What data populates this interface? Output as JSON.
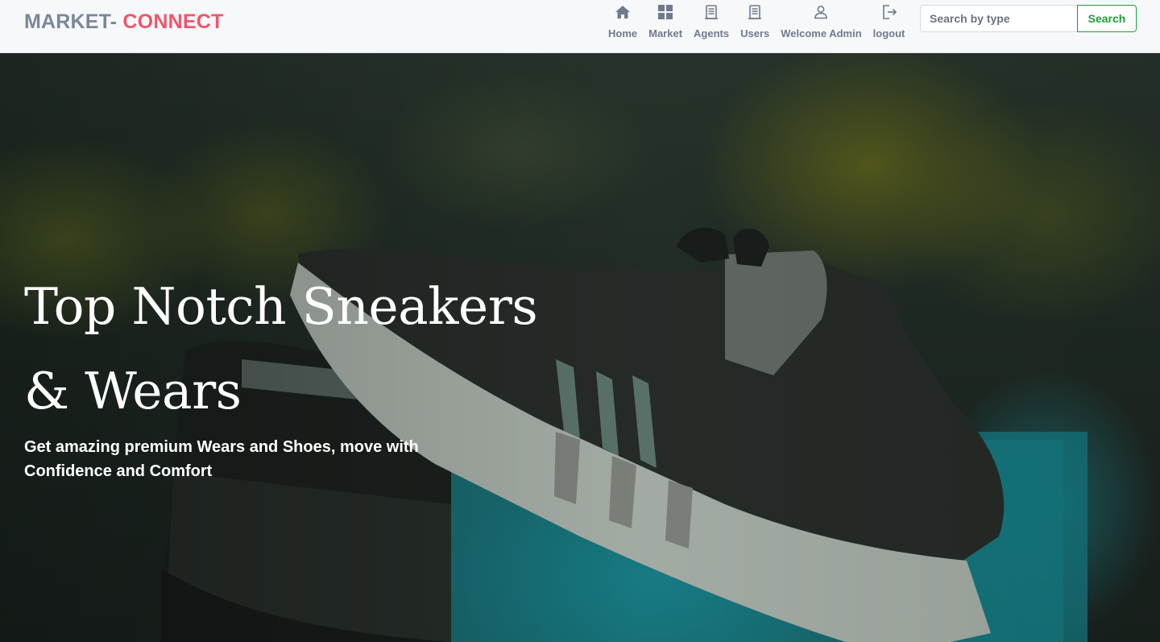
{
  "colors": {
    "brand_gray": "#7a8799",
    "brand_red": "#f0566b",
    "accent_green": "#1f9d3a",
    "nav_text": "#6f7a8e"
  },
  "brand": {
    "part1": "MARKET-",
    "part2": " CONNECT"
  },
  "nav": {
    "items": [
      {
        "label": "Home",
        "icon": "home-icon"
      },
      {
        "label": "Market",
        "icon": "grid-icon"
      },
      {
        "label": "Agents",
        "icon": "document-icon"
      },
      {
        "label": "Users",
        "icon": "document-list-icon"
      },
      {
        "label": "Welcome Admin",
        "icon": "user-icon"
      },
      {
        "label": "logout",
        "icon": "logout-icon"
      }
    ]
  },
  "search": {
    "placeholder": "Search by type",
    "value": "",
    "button_label": "Search"
  },
  "hero": {
    "title_line1": "Top Notch Sneakers",
    "title_line2": "& Wears",
    "subtitle_line1": "Get amazing premium Wears and Shoes, move with",
    "subtitle_line2": "Confidence and Comfort",
    "image": "sneakers-photo"
  }
}
